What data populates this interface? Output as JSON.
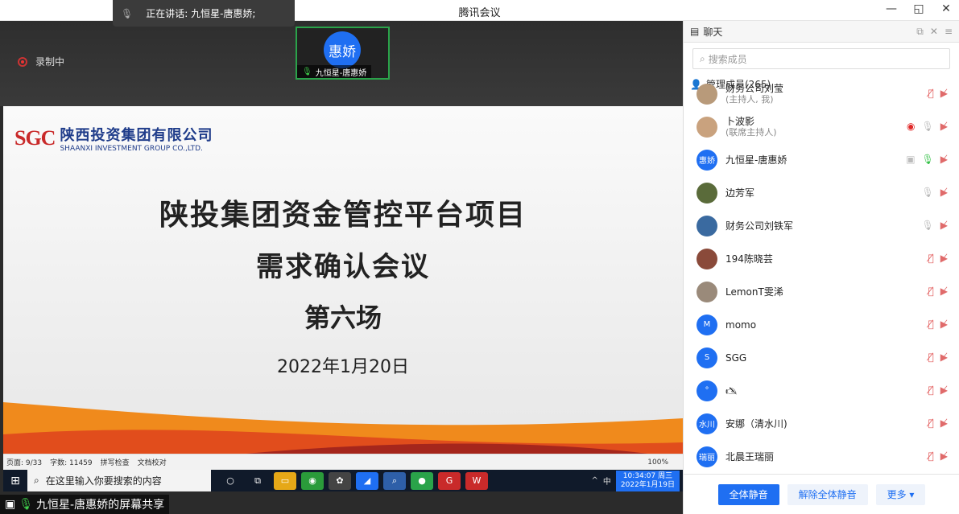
{
  "window": {
    "title": "腾讯会议",
    "buttons": [
      "—",
      "◱",
      "✕"
    ]
  },
  "speaking": {
    "text": "正在讲话: 九恒星-唐惠娇;"
  },
  "recording": {
    "label": "录制中"
  },
  "video_tile": {
    "avatar_text": "惠娇",
    "name": "九恒星-唐惠娇"
  },
  "slide": {
    "logo_mark": "SGC",
    "company_cn": "陕西投资集团有限公司",
    "company_en": "SHAANXI INVESTMENT GROUP CO.,LTD.",
    "title1": "陕投集团资金管控平台项目",
    "title2": "需求确认会议",
    "title3": "第六场",
    "date": "2022年1月20日"
  },
  "doc_status": {
    "page": "页面: 9/33",
    "words": "字数: 11459",
    "spell": "拼写检查",
    "proof": "文档校对",
    "zoom": "100%"
  },
  "taskbar": {
    "search_placeholder": "在这里输入你要搜索的内容",
    "time": "10:34:07 周三",
    "date": "2022年1月19日",
    "ime": "中"
  },
  "share_label": "九恒星-唐惠娇的屏幕共享",
  "panel": {
    "tab_chat": "聊天",
    "tab_members": "管理成员(265)",
    "search_placeholder": "搜索成员",
    "members": [
      {
        "name": "财务公司刘莹",
        "role": "(主持人, 我)",
        "avatar": "",
        "color": "#b89a7a",
        "mic": "muted"
      },
      {
        "name": "卜波影",
        "role": "(联席主持人)",
        "avatar": "",
        "color": "#c9a27e",
        "mic": "off",
        "recording": true
      },
      {
        "name": "九恒星-唐惠娇",
        "role": "",
        "avatar": "惠娇",
        "color": "#1f6ff2",
        "mic": "on",
        "sharing": true
      },
      {
        "name": "边芳军",
        "role": "",
        "avatar": "",
        "color": "#5a6b3a",
        "mic": "off"
      },
      {
        "name": "财务公司刘铁军",
        "role": "",
        "avatar": "",
        "color": "#3a6aa0",
        "mic": "off"
      },
      {
        "name": "194陈晓芸",
        "role": "",
        "avatar": "",
        "color": "#8a4a3a",
        "mic": "muted"
      },
      {
        "name": "LemonT雯浠",
        "role": "",
        "avatar": "",
        "color": "#9a8a7a",
        "mic": "muted"
      },
      {
        "name": "momo",
        "role": "",
        "avatar": "M",
        "color": "#1f6ff2",
        "mic": "muted"
      },
      {
        "name": "SGG",
        "role": "",
        "avatar": "S",
        "color": "#1f6ff2",
        "mic": "muted"
      },
      {
        "name": "🖎",
        "role": "",
        "avatar": "°",
        "color": "#1f6ff2",
        "mic": "muted"
      },
      {
        "name": "安娜（清水川)",
        "role": "",
        "avatar": "水川",
        "color": "#1f6ff2",
        "mic": "muted"
      },
      {
        "name": "北晨王瑞丽",
        "role": "",
        "avatar": "瑞丽",
        "color": "#1f6ff2",
        "mic": "muted"
      }
    ],
    "btn_mute_all": "全体静音",
    "btn_unmute_all": "解除全体静音",
    "btn_more": "更多 ▾"
  }
}
